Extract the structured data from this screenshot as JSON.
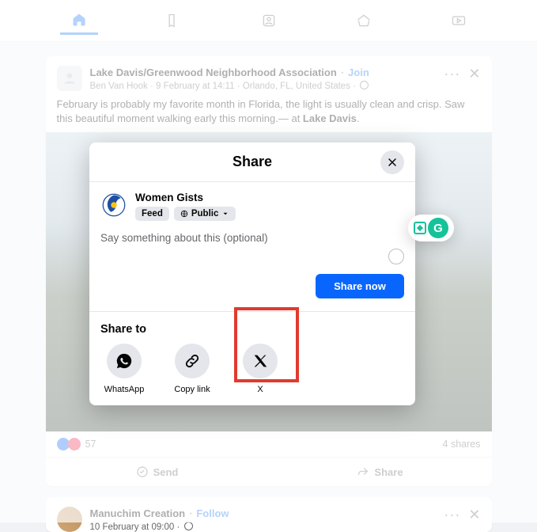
{
  "post1": {
    "group": "Lake Davis/Greenwood Neighborhood Association",
    "join": "Join",
    "author": "Ben Van Hook",
    "timestamp": "9 February at 14:11",
    "location": "Orlando, FL, United States",
    "text_a": "February is probably my favorite month in Florida, the light is usually clean and crisp. Saw this beautiful moment walking early this morning.— at ",
    "text_b": "Lake Davis",
    "text_c": ".",
    "reactions_count": "57",
    "shares_label": "4 shares",
    "send_label": "Send",
    "share_label": "Share"
  },
  "modal": {
    "title": "Share",
    "page_name": "Women Gists",
    "feed_pill": "Feed",
    "public_pill": "Public",
    "placeholder": "Say something about this (optional)",
    "share_now": "Share now",
    "share_to": "Share to",
    "targets": {
      "whatsapp": "WhatsApp",
      "copylink": "Copy link",
      "x": "X"
    }
  },
  "post2": {
    "author": "Manuchim Creation",
    "follow": "Follow",
    "timestamp": "10 February at 09:00"
  },
  "colors": {
    "accent": "#1877f2",
    "primary_btn": "#0866ff",
    "highlight": "#e13a2e"
  }
}
